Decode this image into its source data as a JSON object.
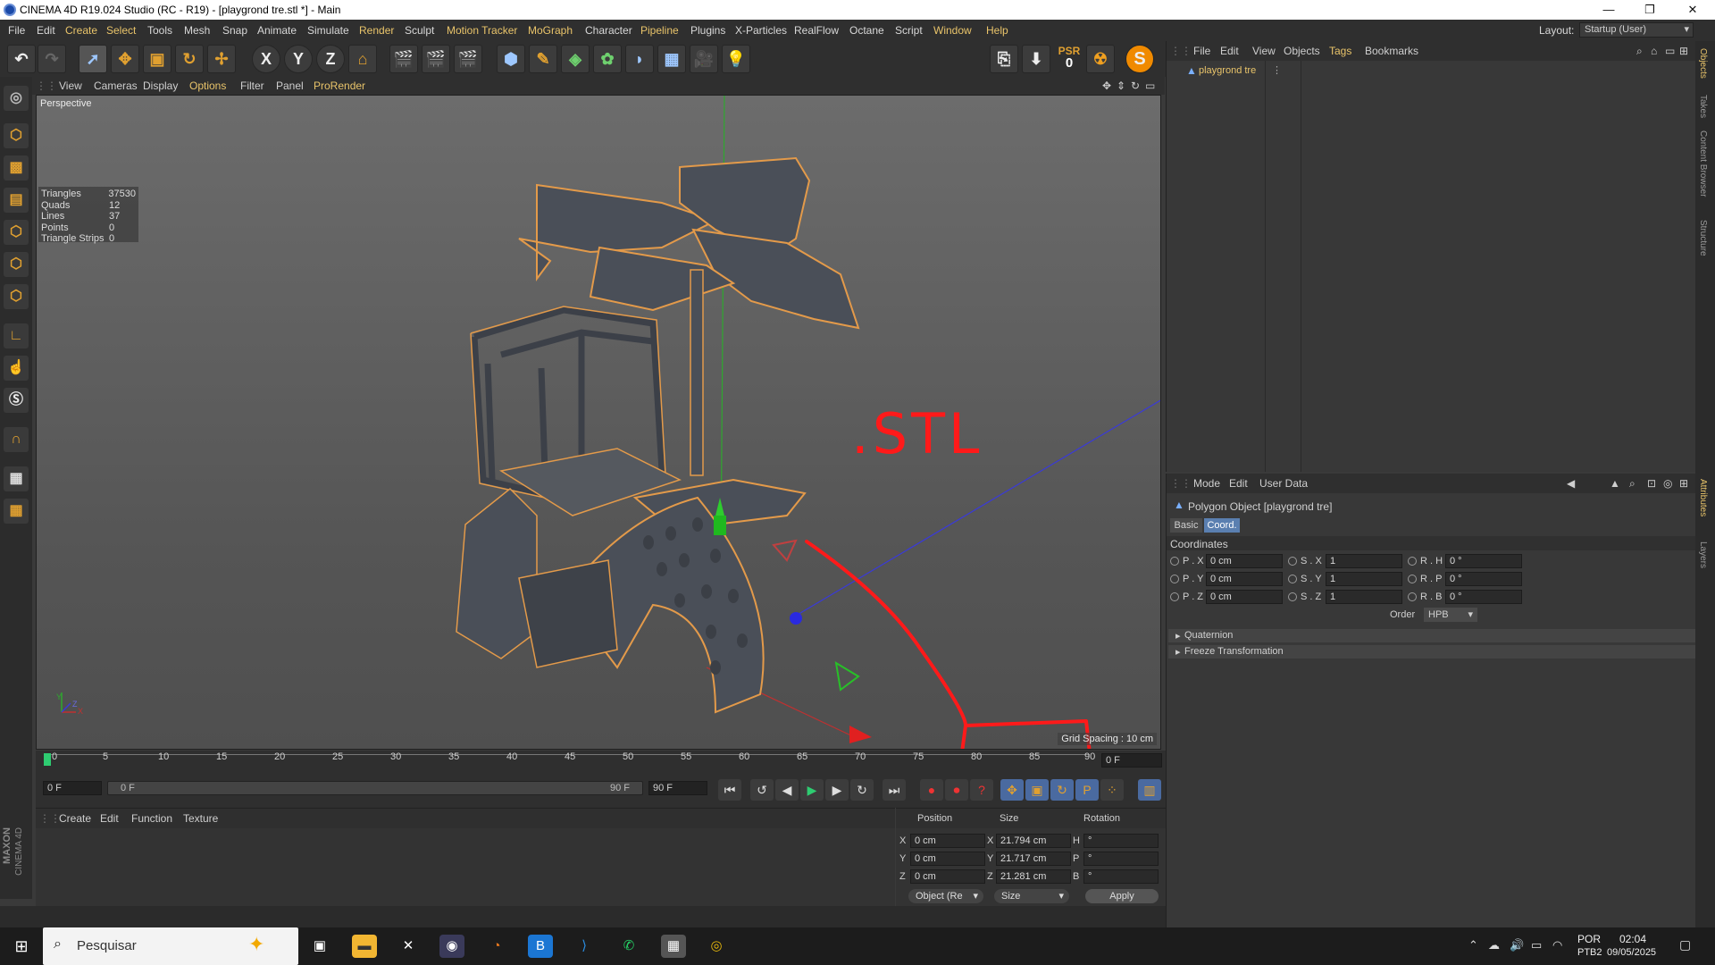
{
  "window": {
    "title": "CINEMA 4D R19.024 Studio (RC - R19) - [playgrond tre.stl *] - Main",
    "minimize": "—",
    "restore": "❐",
    "close": "✕"
  },
  "menubar": {
    "items": [
      "File",
      "Edit",
      "Create",
      "Select",
      "Tools",
      "Mesh",
      "Snap",
      "Animate",
      "Simulate",
      "Render",
      "Sculpt",
      "Motion Tracker",
      "MoGraph",
      "Character",
      "Pipeline",
      "Plugins",
      "X-Particles",
      "RealFlow",
      "Octane",
      "Script",
      "Window",
      "Help"
    ],
    "layout_label": "Layout:",
    "layout_value": "Startup (User)"
  },
  "toolbar": {
    "icons": [
      "undo-icon",
      "redo-icon",
      "select-icon",
      "move-icon",
      "scale-icon",
      "rotate-icon",
      "transform-icon",
      "x-axis-icon",
      "y-axis-icon",
      "z-axis-icon",
      "coordinate-system-icon",
      "render-view-icon",
      "render-picture-viewer-icon",
      "render-settings-icon",
      "cube-icon",
      "pen-icon",
      "subdivision-icon",
      "cloner-icon",
      "deformer-icon",
      "floor-icon",
      "camera-icon",
      "light-icon"
    ],
    "axis_x": "X",
    "axis_y": "Y",
    "axis_z": "Z",
    "psr": "PSR",
    "psr_value": "0"
  },
  "viewport": {
    "menu": [
      "View",
      "Cameras",
      "Display",
      "Options",
      "Filter",
      "Panel",
      "ProRender"
    ],
    "label": "Perspective",
    "stats": [
      {
        "k": "Triangles",
        "v": "37530"
      },
      {
        "k": "Quads",
        "v": "12"
      },
      {
        "k": "Lines",
        "v": "37"
      },
      {
        "k": "Points",
        "v": "0"
      },
      {
        "k": "Triangle Strips",
        "v": "0"
      }
    ],
    "grid_spacing": "Grid Spacing : 10 cm",
    "annotation": ".STL",
    "axis_y": "Y",
    "axis_x": "X",
    "axis_z": "Z"
  },
  "timeline": {
    "ticks": [
      "0",
      "5",
      "10",
      "15",
      "20",
      "25",
      "30",
      "35",
      "40",
      "45",
      "50",
      "55",
      "60",
      "65",
      "70",
      "75",
      "80",
      "85",
      "90"
    ],
    "current_frame": "0 F",
    "start_field": "0 F",
    "range_start": "0 F",
    "range_end": "90 F",
    "end_field": "90 F"
  },
  "material_manager": {
    "menu": [
      "Create",
      "Edit",
      "Function",
      "Texture"
    ]
  },
  "coord_manager": {
    "headers": [
      "Position",
      "Size",
      "Rotation"
    ],
    "rows": [
      {
        "axis": "X",
        "pos": "0 cm",
        "size_axis": "X",
        "size": "21.794 cm",
        "rot_axis": "H",
        "rot": "°"
      },
      {
        "axis": "Y",
        "pos": "0 cm",
        "size_axis": "Y",
        "size": "21.717 cm",
        "rot_axis": "P",
        "rot": "°"
      },
      {
        "axis": "Z",
        "pos": "0 cm",
        "size_axis": "Z",
        "size": "21.281 cm",
        "rot_axis": "B",
        "rot": "°"
      }
    ],
    "mode": "Object (Re",
    "size_mode": "Size",
    "apply": "Apply"
  },
  "object_manager": {
    "menu": [
      "File",
      "Edit",
      "View",
      "Objects",
      "Tags",
      "Bookmarks"
    ],
    "object_name": "playgrond tre"
  },
  "attributes": {
    "menu": [
      "Mode",
      "Edit",
      "User Data"
    ],
    "object_title": "Polygon Object [playgrond tre]",
    "tabs": [
      "Basic",
      "Coord."
    ],
    "section": "Coordinates",
    "rows": [
      {
        "p": "P . X",
        "pv": "0 cm",
        "s": "S . X",
        "sv": "1",
        "r": "R . H",
        "rv": "0 °"
      },
      {
        "p": "P . Y",
        "pv": "0 cm",
        "s": "S . Y",
        "sv": "1",
        "r": "R . P",
        "rv": "0 °"
      },
      {
        "p": "P . Z",
        "pv": "0 cm",
        "s": "S . Z",
        "sv": "1",
        "r": "R . B",
        "rv": "0 °"
      }
    ],
    "order_label": "Order",
    "order_value": "HPB",
    "collapsibles": [
      "Quaternion",
      "Freeze Transformation"
    ]
  },
  "side_tabs": [
    "Objects",
    "Takes",
    "Content Browser",
    "Structure",
    "Attributes",
    "Layers"
  ],
  "branding": {
    "maxon": "MAXON",
    "c4d": "CINEMA 4D"
  },
  "taskbar": {
    "search_placeholder": "Pesquisar",
    "lang": "POR",
    "lang2": "PTB2",
    "time": "02:04",
    "date": "09/05/2025"
  },
  "colors": {
    "accent_orange": "#e0a030",
    "annotation_red": "#ff1a1a",
    "outline": "#e39a4a"
  }
}
